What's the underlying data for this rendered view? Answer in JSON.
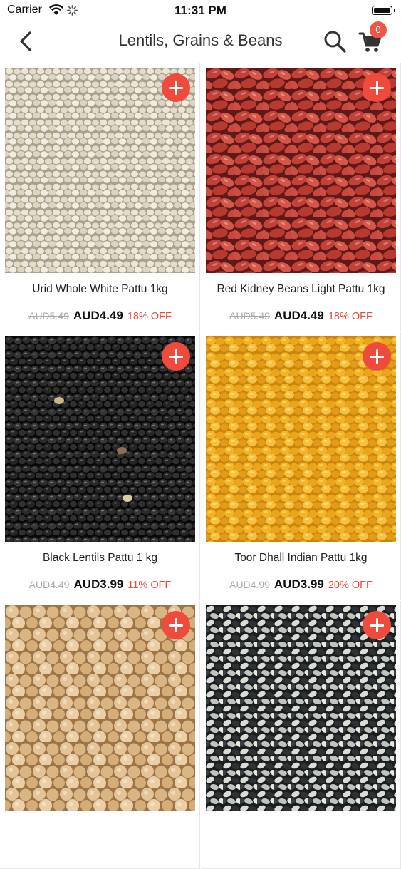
{
  "status_bar": {
    "carrier": "Carrier",
    "time": "11:31 PM"
  },
  "nav": {
    "title": "Lentils, Grains & Beans",
    "cart_count": "0"
  },
  "colors": {
    "accent": "#ef4a3c",
    "discount": "#e8483b"
  },
  "products": [
    {
      "name": "Urid Whole White Pattu 1kg",
      "old_price": "AUD5.49",
      "price": "AUD4.49",
      "discount": "18% OFF"
    },
    {
      "name": "Red Kidney Beans Light Pattu 1kg",
      "old_price": "AUD5.49",
      "price": "AUD4.49",
      "discount": "18% OFF"
    },
    {
      "name": "Black Lentils Pattu 1 kg",
      "old_price": "AUD4.49",
      "price": "AUD3.99",
      "discount": "11% OFF"
    },
    {
      "name": "Toor Dhall Indian Pattu 1kg",
      "old_price": "AUD4.99",
      "price": "AUD3.99",
      "discount": "20% OFF"
    },
    {
      "name": "",
      "old_price": "",
      "price": "",
      "discount": ""
    },
    {
      "name": "",
      "old_price": "",
      "price": "",
      "discount": ""
    }
  ]
}
